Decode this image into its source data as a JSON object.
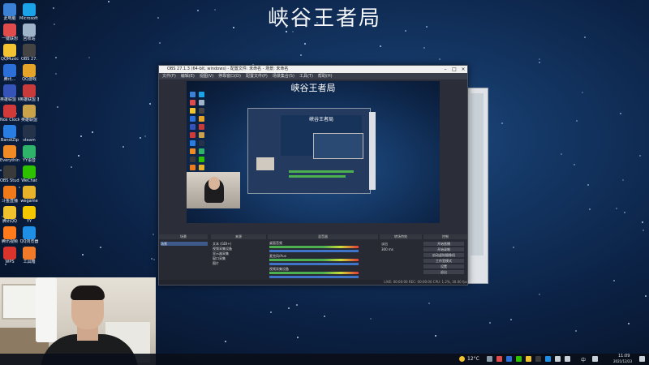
{
  "headline": "峡谷王者局",
  "desktop_icons": [
    {
      "label": "此电脑",
      "icon": "computer-icon",
      "color": "#3b82d6"
    },
    {
      "label": "Microsoft Edge",
      "icon": "edge-icon",
      "color": "#1aa3e8"
    },
    {
      "label": "一键联想",
      "icon": "app-icon",
      "color": "#e04b4b"
    },
    {
      "label": "回收站",
      "icon": "recycle-bin-icon",
      "color": "#9fb4c8"
    },
    {
      "label": "QQMusic",
      "icon": "music-icon",
      "color": "#f3c432"
    },
    {
      "label": "OBS 27.",
      "icon": "app-icon",
      "color": "#444444"
    },
    {
      "label": "腾讯...",
      "icon": "app-icon",
      "color": "#2d6fd8"
    },
    {
      "label": "QQ游戏",
      "icon": "game-icon",
      "color": "#e6a32a"
    },
    {
      "label": "英雄联盟 WeGame版",
      "icon": "game-icon",
      "color": "#3553b8"
    },
    {
      "label": "英雄联盟 客户端",
      "icon": "game-icon",
      "color": "#c83b3b"
    },
    {
      "label": "Nox Clock",
      "icon": "clock-icon",
      "color": "#d23a3a"
    },
    {
      "label": "英雄联盟",
      "icon": "game-icon",
      "color": "#c9a24a"
    },
    {
      "label": "BandiZip",
      "icon": "zip-icon",
      "color": "#2a7de1"
    },
    {
      "label": "steam",
      "icon": "steam-icon",
      "color": "#24324a"
    },
    {
      "label": "Everything",
      "icon": "search-icon",
      "color": "#f08a24"
    },
    {
      "label": "YY语音",
      "icon": "app-icon",
      "color": "#2fb36b"
    },
    {
      "label": "OBS Studio",
      "icon": "obs-icon",
      "color": "#3a3a3a"
    },
    {
      "label": "WeChat",
      "icon": "wechat-icon",
      "color": "#2dc100"
    },
    {
      "label": "斗鱼直播",
      "icon": "app-icon",
      "color": "#f07a1a"
    },
    {
      "label": "wegame",
      "icon": "app-icon",
      "color": "#e8b22a"
    },
    {
      "label": "腾讯QQ",
      "icon": "qq-icon",
      "color": "#f2c12e"
    },
    {
      "label": "YY",
      "icon": "app-icon",
      "color": "#f3c800"
    },
    {
      "label": "腾讯视频",
      "icon": "video-icon",
      "color": "#ff7a1a"
    },
    {
      "label": "QQ浏览器",
      "icon": "browser-icon",
      "color": "#1f8fe6"
    },
    {
      "label": "WPS",
      "icon": "office-icon",
      "color": "#d9342b"
    },
    {
      "label": "工具箱",
      "icon": "app-icon",
      "color": "#ef7b2a"
    }
  ],
  "obs": {
    "title": "OBS 27.1.3 (64-bit, windows) - 配置文件: 未命名 - 场景: 未命名",
    "menu": [
      "文件(F)",
      "编辑(E)",
      "视图(V)",
      "停靠窗口(D)",
      "配置文件(P)",
      "场景集合(S)",
      "工具(T)",
      "帮助(H)"
    ],
    "preview_title": "峡谷王者局",
    "inner_title": "峡谷王者局",
    "panel_headers": [
      "场景",
      "来源",
      "混音器",
      "转场特效",
      "控制"
    ],
    "scene_item": "场景",
    "sources": [
      "文本 (GDI+)",
      "视频采集设备",
      "显示器采集",
      "窗口采集",
      "图片"
    ],
    "mixer_tracks": [
      "桌面音频",
      "麦克风/Aux",
      "视频采集设备"
    ],
    "transition": {
      "type": "淡出",
      "duration": "300 ms"
    },
    "controls": [
      "开始直播",
      "开始录制",
      "启动虚拟摄像机",
      "工作室模式",
      "设置",
      "退出"
    ],
    "status": "LIVE: 00:00:00   REC: 00:00:00   CPU: 1.2%, 30.00 fps"
  },
  "taskbar": {
    "weather": "12°C",
    "time": "11:09",
    "date": "2021/12/23",
    "lang": "中"
  }
}
